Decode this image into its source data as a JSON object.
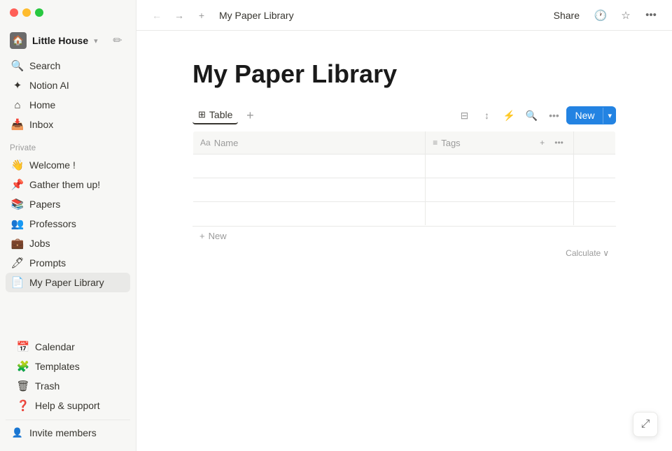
{
  "app": {
    "title": "My Paper Library"
  },
  "sidebar": {
    "workspace": {
      "name": "Little House",
      "icon": "🏠",
      "chevron": "▾"
    },
    "nav_items": [
      {
        "id": "search",
        "icon": "🔍",
        "label": "Search"
      },
      {
        "id": "notion-ai",
        "icon": "✦",
        "label": "Notion AI"
      },
      {
        "id": "home",
        "icon": "⌂",
        "label": "Home"
      },
      {
        "id": "inbox",
        "icon": "📥",
        "label": "Inbox"
      }
    ],
    "private_label": "Private",
    "private_items": [
      {
        "id": "welcome",
        "icon": "👋",
        "label": "Welcome !"
      },
      {
        "id": "gather",
        "icon": "📌",
        "label": "Gather them up!"
      },
      {
        "id": "papers",
        "icon": "📚",
        "label": "Papers"
      },
      {
        "id": "professors",
        "icon": "👥",
        "label": "Professors"
      },
      {
        "id": "jobs",
        "icon": "💼",
        "label": "Jobs"
      },
      {
        "id": "prompts",
        "icon": "🖊",
        "label": "Prompts"
      },
      {
        "id": "my-paper-library",
        "icon": "📄",
        "label": "My Paper Library",
        "active": true
      }
    ],
    "bottom_items": [
      {
        "id": "calendar",
        "icon": "📅",
        "label": "Calendar"
      },
      {
        "id": "templates",
        "icon": "🧩",
        "label": "Templates"
      },
      {
        "id": "trash",
        "icon": "🗑",
        "label": "Trash"
      },
      {
        "id": "help",
        "icon": "❓",
        "label": "Help & support"
      }
    ],
    "invite_label": "Invite members"
  },
  "topbar": {
    "back_arrow": "←",
    "forward_arrow": "→",
    "add_icon": "+",
    "breadcrumb": "My Paper Library",
    "share_label": "Share",
    "history_icon": "🕐",
    "favorite_icon": "☆",
    "more_icon": "···"
  },
  "page": {
    "title": "My Paper Library"
  },
  "table": {
    "view_label": "Table",
    "view_icon": "⊞",
    "add_view_icon": "+",
    "filter_icon": "⊟",
    "sort_icon": "↕",
    "automation_icon": "⚡",
    "search_icon": "🔍",
    "more_icon": "···",
    "new_button": "New",
    "new_chevron": "▾",
    "columns": [
      {
        "id": "name",
        "icon": "Aa",
        "label": "Name"
      },
      {
        "id": "tags",
        "icon": "≡",
        "label": "Tags"
      }
    ],
    "rows": [
      {
        "name": "",
        "tags": ""
      },
      {
        "name": "",
        "tags": ""
      },
      {
        "name": "",
        "tags": ""
      }
    ],
    "add_row_icon": "+",
    "add_row_label": "New",
    "calculate_label": "Calculate",
    "calculate_chevron": "∨"
  }
}
